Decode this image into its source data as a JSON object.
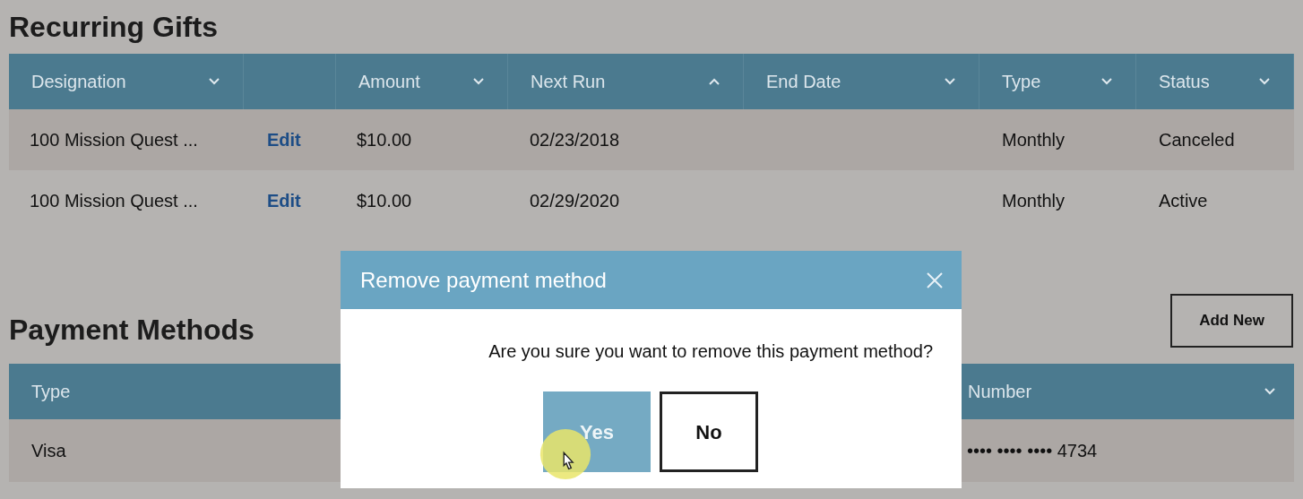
{
  "gifts": {
    "title": "Recurring Gifts",
    "columns": [
      {
        "kind": "label",
        "label": "Designation",
        "sorted": false
      },
      {
        "kind": "blank"
      },
      {
        "kind": "label",
        "label": "Amount",
        "sorted": false
      },
      {
        "kind": "label",
        "label": "Next Run",
        "sorted": true
      },
      {
        "kind": "label",
        "label": "End Date",
        "sorted": false
      },
      {
        "kind": "label",
        "label": "Type",
        "sorted": false
      },
      {
        "kind": "label",
        "label": "Status",
        "sorted": false
      }
    ],
    "rows": [
      {
        "designation": "100 Mission Quest ...",
        "action": "Edit",
        "amount": "$10.00",
        "next_run": "02/23/2018",
        "type": "Monthly",
        "status": "Canceled"
      },
      {
        "designation": "100 Mission Quest ...",
        "action": "Edit",
        "amount": "$10.00",
        "next_run": "02/29/2020",
        "type": "Monthly",
        "status": "Active"
      }
    ]
  },
  "payment_methods": {
    "title": "Payment Methods",
    "add_button": "Add New",
    "columns": [
      {
        "label": "Type"
      },
      {
        "label": "Number"
      }
    ],
    "rows": [
      {
        "type": "Visa",
        "number": "•••• •••• •••• 4734"
      }
    ]
  },
  "dialog": {
    "title": "Remove payment method",
    "message": "Are you sure you want to remove this payment method?",
    "buttons": [
      {
        "label": "Yes",
        "primary": true
      },
      {
        "label": "No",
        "primary": false
      }
    ]
  }
}
